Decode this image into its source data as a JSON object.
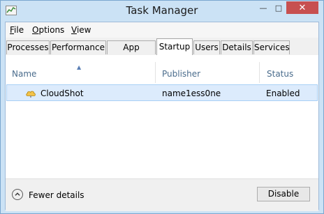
{
  "window": {
    "title": "Task Manager"
  },
  "menu": [
    {
      "key": "F",
      "rest": "ile"
    },
    {
      "key": "O",
      "rest": "ptions"
    },
    {
      "key": "V",
      "rest": "iew"
    }
  ],
  "tabs": [
    "Processes",
    "Performance",
    "App history",
    "Startup",
    "Users",
    "Details",
    "Services"
  ],
  "active_tab": "Startup",
  "columns": {
    "name": "Name",
    "publisher": "Publisher",
    "status": "Status"
  },
  "rows": [
    {
      "icon": "cloud-icon",
      "name": "CloudShot",
      "publisher": "name1ess0ne",
      "status": "Enabled"
    }
  ],
  "bottom": {
    "fewer_details": "Fewer details",
    "disable": "Disable"
  },
  "colors": {
    "accent": "#cbe2f5",
    "selection": "#dcebfc",
    "close": "#c75050"
  }
}
